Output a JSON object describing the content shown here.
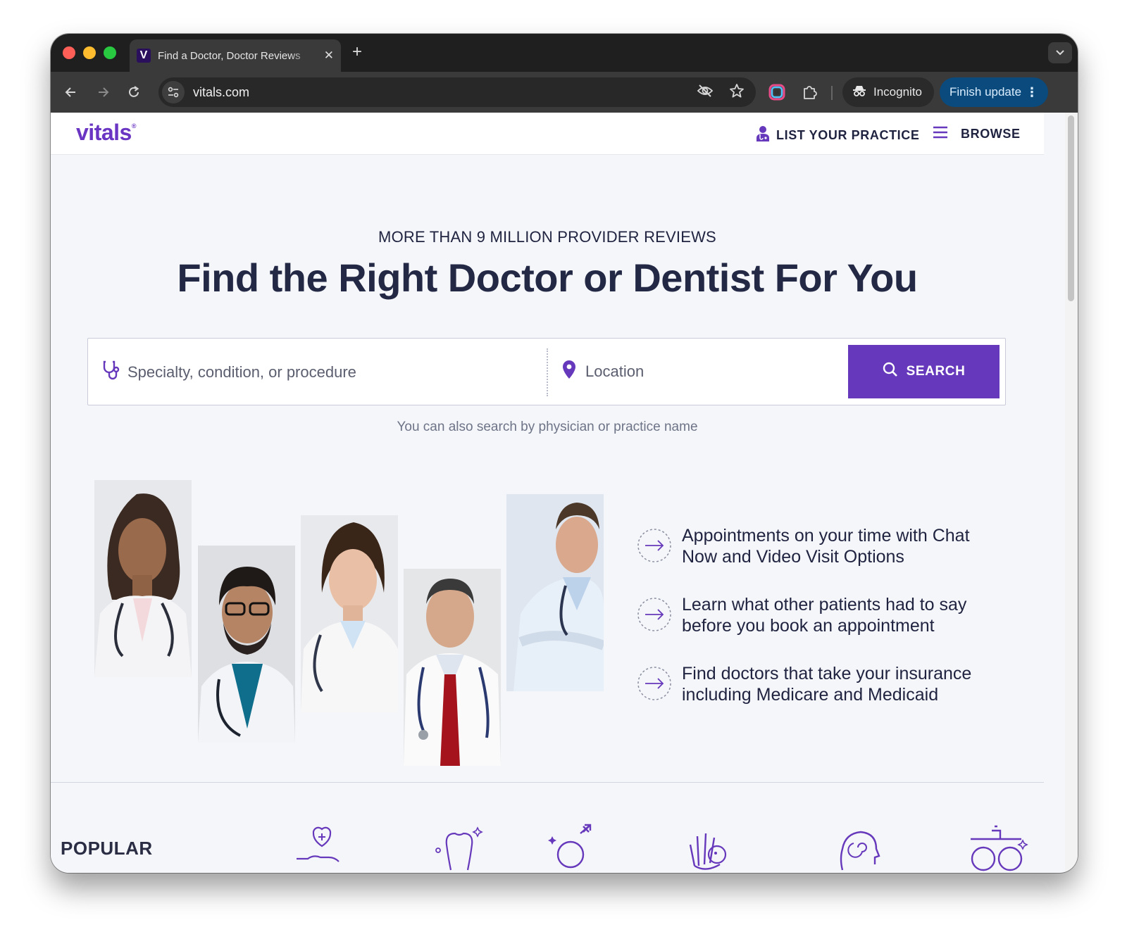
{
  "browser": {
    "tab_title": "Find a Doctor, Doctor Reviews",
    "tab_favicon_letter": "V",
    "url": "vitals.com",
    "incognito_label": "Incognito",
    "finish_update_label": "Finish update"
  },
  "header": {
    "logo": "vitals",
    "list_practice": "LIST YOUR PRACTICE",
    "browse": "BROWSE"
  },
  "hero": {
    "eyebrow": "MORE THAN 9 MILLION PROVIDER REVIEWS",
    "title": "Find the Right Doctor or Dentist For You"
  },
  "search": {
    "specialty_placeholder": "Specialty, condition, or procedure",
    "location_placeholder": "Location",
    "button_label": "SEARCH",
    "hint": "You can also search by physician or practice name"
  },
  "features": [
    {
      "text": "Appointments on your time with Chat Now and Video Visit Options"
    },
    {
      "text": "Learn what other patients had to say before you book an appointment"
    },
    {
      "text": "Find doctors that take your insurance including Medicare and Medicaid"
    }
  ],
  "popular": {
    "heading": "POPULAR"
  },
  "colors": {
    "brand": "#6638bb",
    "logo": "#6a35c2",
    "text_dark": "#232845"
  }
}
